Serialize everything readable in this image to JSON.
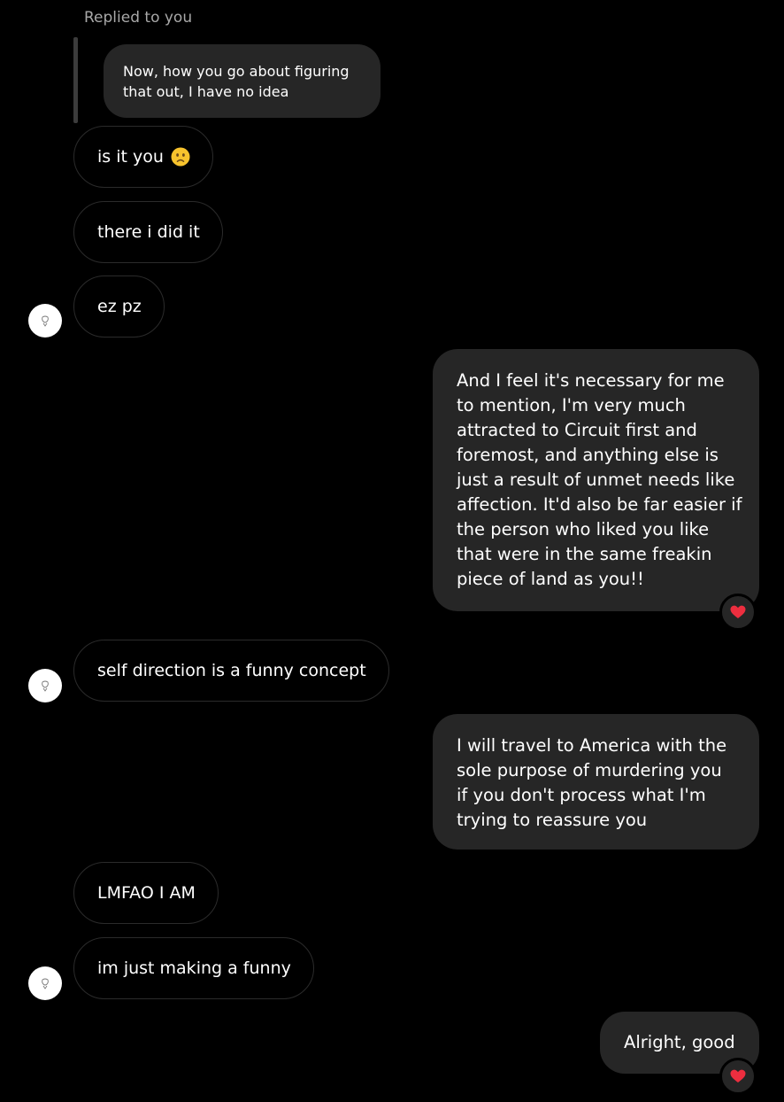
{
  "reply": {
    "label": "Replied to you",
    "quoted_lines": [
      "Now, how you go about figuring",
      "that out, I have no idea"
    ]
  },
  "messages": [
    {
      "text": "is it you",
      "emoji": "worried-face-emoji"
    },
    {
      "text": "there i did it"
    },
    {
      "text": "ez pz"
    },
    {
      "lines": [
        "And I feel it's necessary for me",
        "to mention, I'm very much",
        "attracted to Circuit first and",
        "foremost, and anything else is",
        "just a result of unmet needs like",
        "affection. It'd also be far easier if",
        "the person who liked you like",
        "that were in the same freakin",
        "piece of land as you!!"
      ],
      "reaction": "heart-icon"
    },
    {
      "text": "self direction is a funny concept"
    },
    {
      "lines": [
        "I will travel to America with the",
        "sole purpose of murdering you",
        "if you don't process what I'm",
        "trying to reassure you"
      ]
    },
    {
      "text": "LMFAO I AM"
    },
    {
      "text": "im just making a funny"
    },
    {
      "text": "Alright, good",
      "reaction": "heart-icon"
    }
  ],
  "colors": {
    "background": "#000000",
    "bubble_outgoing": "#262626",
    "bubble_incoming_border": "#2b2b2b",
    "reply_label": "#a8a8a8",
    "heart": "#ed2e3f",
    "emoji": "#f7c32d"
  },
  "icons": [
    "avatar-icon",
    "heart-icon",
    "worried-face-emoji"
  ]
}
